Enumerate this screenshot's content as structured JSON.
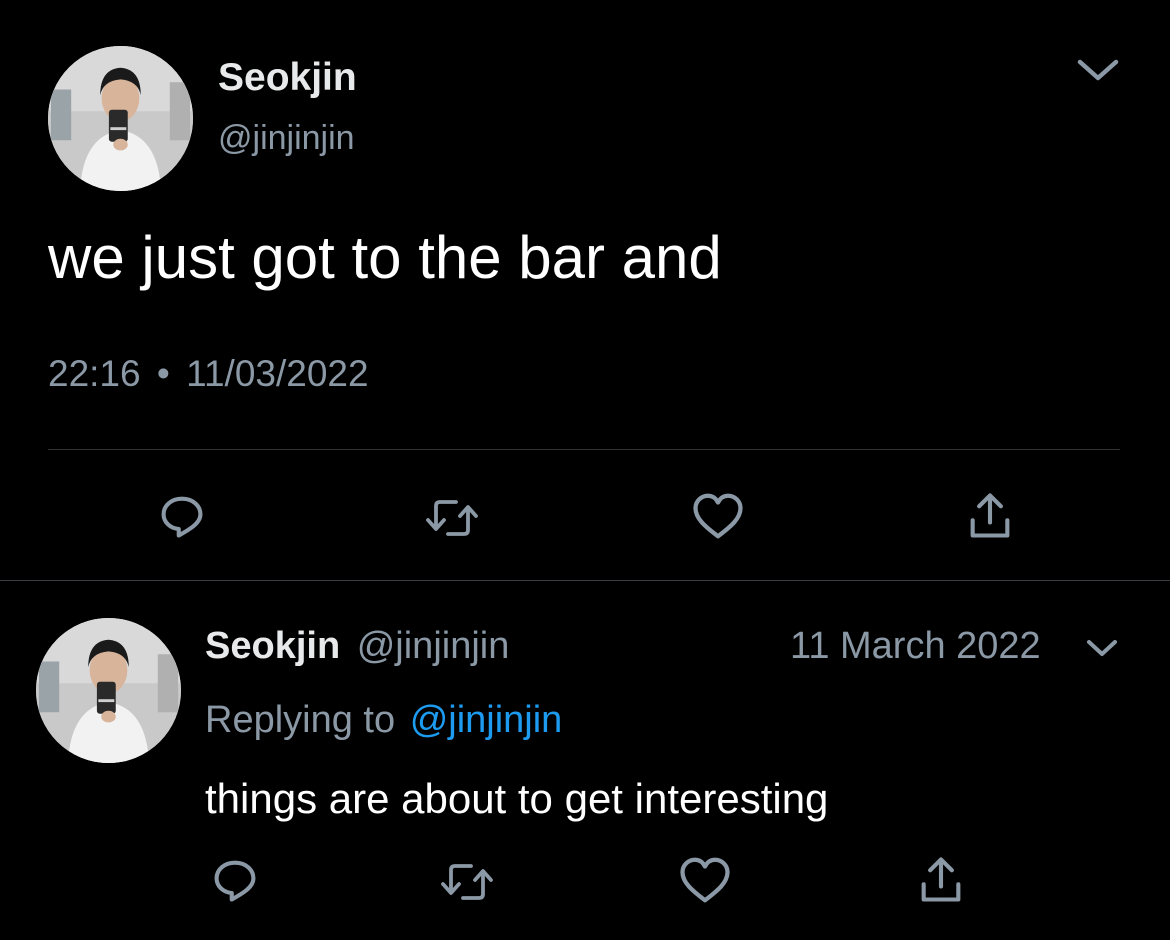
{
  "main_tweet": {
    "display_name": "Seokjin",
    "handle": "@jinjinjin",
    "text": "we just got to the bar and",
    "time": "22:16",
    "separator": "•",
    "date": "11/03/2022",
    "more_icon": "chevron-down-icon"
  },
  "actions": [
    {
      "name": "reply",
      "icon": "reply-icon"
    },
    {
      "name": "retweet",
      "icon": "retweet-icon"
    },
    {
      "name": "like",
      "icon": "heart-icon"
    },
    {
      "name": "share",
      "icon": "share-icon"
    }
  ],
  "reply_tweet": {
    "display_name": "Seokjin",
    "handle": "@jinjinjin",
    "date": "11 March 2022",
    "replying_label": "Replying to",
    "replying_handle": "@jinjinjin",
    "text": "things are about to get interesting"
  },
  "colors": {
    "background": "#000000",
    "text": "#ffffff",
    "muted": "#8b98a5",
    "link": "#1d9bf0",
    "divider": "#2f3336"
  }
}
